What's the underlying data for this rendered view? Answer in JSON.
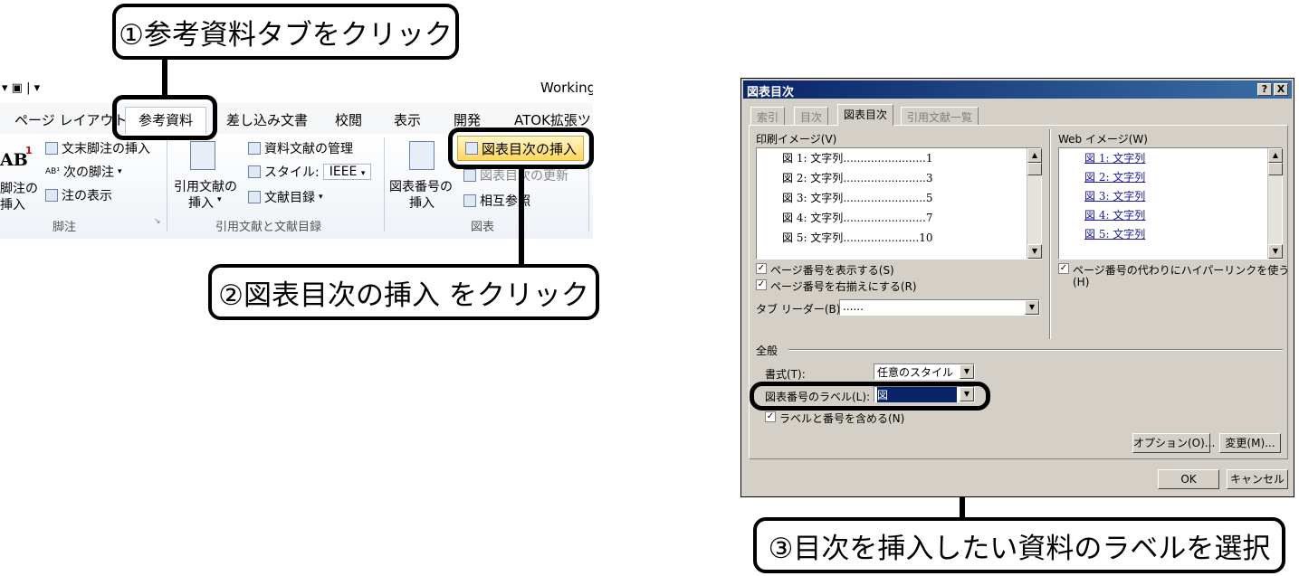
{
  "callouts": {
    "step1": "①参考資料タブをクリック",
    "step2": "②図表目次の挿入 をクリック",
    "step3": "③目次を挿入したい資料のラベルを選択"
  },
  "ribbon": {
    "window_title": "Working",
    "tabs": [
      "ページ レイアウト",
      "参考資料",
      "差し込み文書",
      "校閲",
      "表示",
      "開発",
      "ATOK拡張ツー"
    ],
    "active_tab": "参考資料",
    "footnotes": {
      "insert_endnote": "文末脚注の挿入",
      "next_footnote": "次の脚注",
      "show_notes": "注の表示",
      "insert_footnote_line1": "脚注の",
      "insert_footnote_line2": "挿入",
      "group_label": "脚注",
      "ab_icon": "AB"
    },
    "citations": {
      "insert_citation_line1": "引用文献の",
      "insert_citation_line2": "挿入",
      "manage_sources": "資料文献の管理",
      "style_label": "スタイル:",
      "style_value": "IEEE",
      "bibliography": "文献目録",
      "group_label": "引用文献と文献目録"
    },
    "captions": {
      "insert_caption_line1": "図表番号の",
      "insert_caption_line2": "挿入",
      "insert_table_of_figures": "図表目次の挿入",
      "update_table": "図表目次の更新",
      "cross_reference": "相互参照",
      "group_label": "図表"
    }
  },
  "dialog": {
    "title": "図表目次",
    "help_button": "?",
    "close_button": "X",
    "tabs": [
      "索引",
      "目次",
      "図表目次",
      "引用文献一覧"
    ],
    "active_tab": "図表目次",
    "print_preview_label": "印刷イメージ(V)",
    "print_preview_rows": [
      {
        "label": "図 1: 文字列",
        "page": "1"
      },
      {
        "label": "図 2: 文字列",
        "page": "3"
      },
      {
        "label": "図 3: 文字列",
        "page": "5"
      },
      {
        "label": "図 4: 文字列",
        "page": "7"
      },
      {
        "label": "図 5: 文字列",
        "page": "10"
      }
    ],
    "web_preview_label": "Web イメージ(W)",
    "web_preview_rows": [
      "図 1: 文字列",
      "図 2: 文字列",
      "図 3: 文字列",
      "図 4: 文字列",
      "図 5: 文字列"
    ],
    "show_page_numbers": "ページ番号を表示する(S)",
    "right_align_page_numbers": "ページ番号を右揃えにする(R)",
    "use_hyperlinks_line1": "ページ番号の代わりにハイパーリンクを使う",
    "use_hyperlinks_line2": "(H)",
    "tab_leader_label": "タブ リーダー(B):",
    "tab_leader_value": "......",
    "general_label": "全般",
    "format_label": "書式(T):",
    "format_value": "任意のスタイル",
    "caption_label_label": "図表番号のラベル(L):",
    "caption_label_value": "図",
    "include_label_and_number": "ラベルと番号を含める(N)",
    "options_button": "オプション(O)...",
    "modify_button": "変更(M)...",
    "ok_button": "OK",
    "cancel_button": "キャンセル",
    "check_mark": "✓"
  }
}
